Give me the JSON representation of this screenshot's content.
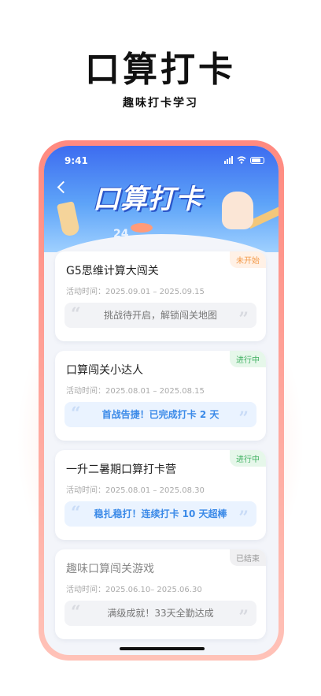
{
  "promo": {
    "title": "口算打卡",
    "subtitle": "趣味打卡学习"
  },
  "status_bar": {
    "time": "9:41"
  },
  "header": {
    "logo_text": "口算打卡",
    "deco_numbers": "24"
  },
  "cards": [
    {
      "title": "G5思维计算大闯关",
      "date": "活动时间：2025.09.01 – 2025.09.15",
      "status": "未开始",
      "message": "挑战待开启，解锁闯关地图"
    },
    {
      "title": "口算闯关小达人",
      "date": "活动时间：2025.08.01 – 2025.08.15",
      "status": "进行中",
      "message": "首战告捷！已完成打卡 2 天"
    },
    {
      "title": "一升二暑期口算打卡营",
      "date": "活动时间：2025.08.01 – 2025.08.30",
      "status": "进行中",
      "message": "稳扎稳打！连续打卡 10 天超棒"
    },
    {
      "title": "趣味口算闯关游戏",
      "date": "活动时间：2025.06.10– 2025.06.30",
      "status": "已结束",
      "message": "满级成就！33天全勤达成"
    }
  ],
  "quote_marks": {
    "open": "“",
    "close": "”"
  },
  "colors": {
    "header_blue": "#3d6cf0",
    "pending": "#f39a4a",
    "active": "#3fb060",
    "active_message": "#3b8ae8",
    "ended": "#999999",
    "frame": "#ff8a80"
  }
}
